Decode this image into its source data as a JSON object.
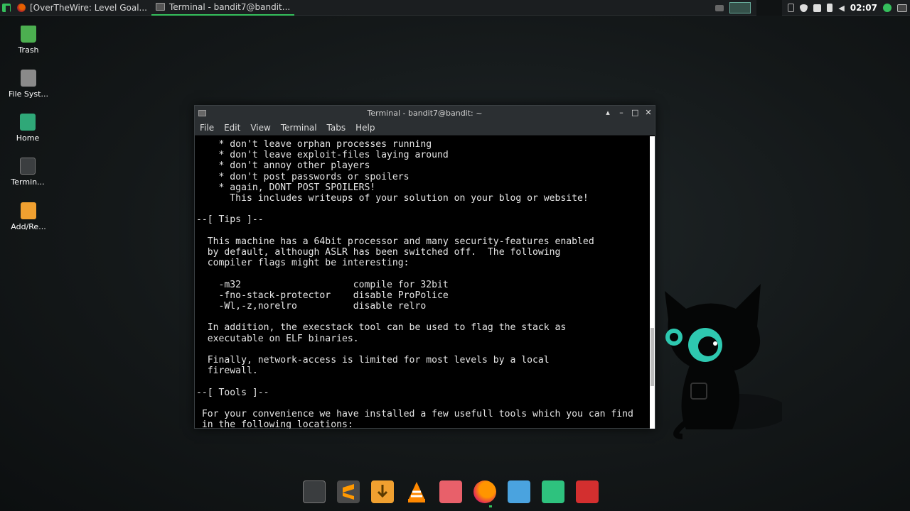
{
  "top_panel": {
    "tasks": [
      {
        "label": "[OverTheWire: Level Goal..."
      },
      {
        "label": "Terminal - bandit7@bandit..."
      }
    ],
    "clock": "02:07"
  },
  "desktop": {
    "icons": [
      {
        "label": "Trash"
      },
      {
        "label": "File Syst..."
      },
      {
        "label": "Home"
      },
      {
        "label": "Termin..."
      },
      {
        "label": "Add/Re..."
      }
    ]
  },
  "window": {
    "title": "Terminal - bandit7@bandit: ~",
    "menu": [
      "File",
      "Edit",
      "View",
      "Terminal",
      "Tabs",
      "Help"
    ],
    "lines": [
      "    * don't leave orphan processes running",
      "    * don't leave exploit-files laying around",
      "    * don't annoy other players",
      "    * don't post passwords or spoilers",
      "    * again, DONT POST SPOILERS!",
      "      This includes writeups of your solution on your blog or website!",
      "",
      "--[ Tips ]--",
      "",
      "  This machine has a 64bit processor and many security-features enabled",
      "  by default, although ASLR has been switched off.  The following",
      "  compiler flags might be interesting:",
      "",
      "    -m32                    compile for 32bit",
      "    -fno-stack-protector    disable ProPolice",
      "    -Wl,-z,norelro          disable relro",
      "",
      "  In addition, the execstack tool can be used to flag the stack as",
      "  executable on ELF binaries.",
      "",
      "  Finally, network-access is limited for most levels by a local",
      "  firewall.",
      "",
      "--[ Tools ]--",
      "",
      " For your convenience we have installed a few usefull tools which you can find",
      " in the following locations:"
    ]
  },
  "dock": {
    "items": [
      "terminal-icon",
      "sublime-text-icon",
      "download-icon",
      "vlc-icon",
      "image-viewer-icon",
      "firefox-icon",
      "files-icon",
      "system-monitor-icon",
      "document-viewer-icon"
    ]
  },
  "colors": {
    "accent": "#35bf5c",
    "terminal_bg": "#000000",
    "panel_bg": "#1b1e20"
  }
}
